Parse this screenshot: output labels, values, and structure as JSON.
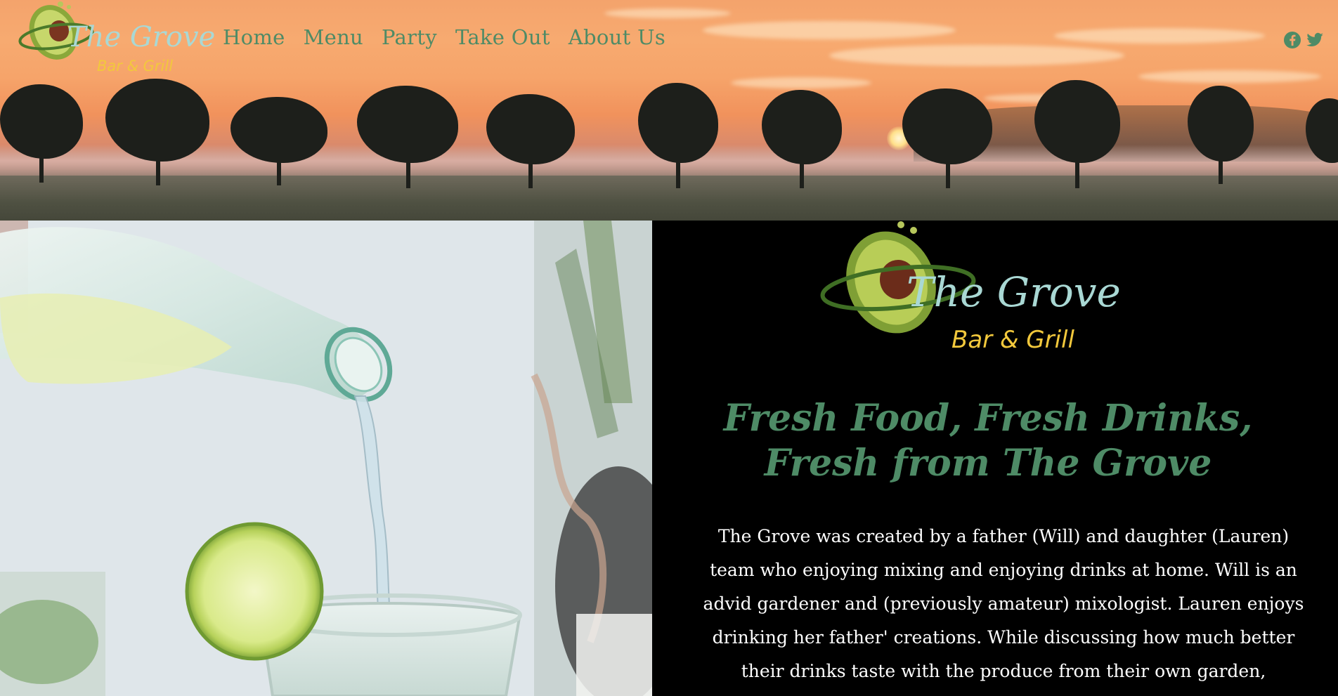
{
  "header": {
    "logo": {
      "name": "The Grove",
      "tagline": "Bar & Grill"
    },
    "nav": [
      {
        "label": "Home"
      },
      {
        "label": "Menu"
      },
      {
        "label": "Party"
      },
      {
        "label": "Take Out"
      },
      {
        "label": "About Us"
      }
    ],
    "social": [
      {
        "icon": "facebook-icon",
        "color": "#4e8b66"
      },
      {
        "icon": "twitter-icon",
        "color": "#4e8b66"
      }
    ]
  },
  "main": {
    "logo": {
      "name": "The Grove",
      "tagline": "Bar & Grill"
    },
    "headline": "Fresh Food, Fresh Drinks, Fresh from The Grove",
    "about": "The Grove was created by a father (Will) and daughter (Lauren) team who enjoying mixing and enjoying drinks at home. Will is an advid gardener and (previously amateur) mixologist. Lauren enjoys drinking her father' creations. While discussing how much better their drinks taste with the produce from their own garden,"
  },
  "colors": {
    "accent": "#4e8b66",
    "logo_text": "#a9d8d4",
    "tagline": "#f2c83c",
    "background": "#000000"
  }
}
